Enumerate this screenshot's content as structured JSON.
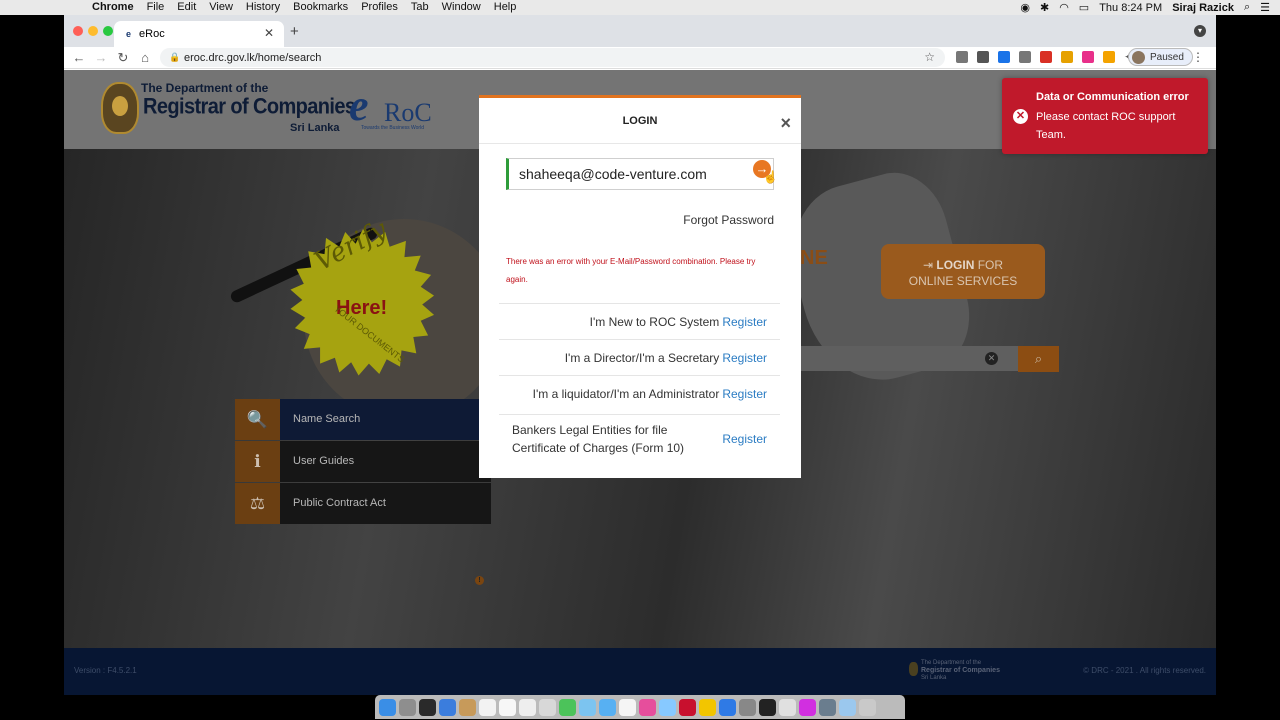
{
  "menubar": {
    "app": "Chrome",
    "items": [
      "File",
      "Edit",
      "View",
      "History",
      "Bookmarks",
      "Profiles",
      "Tab",
      "Window",
      "Help"
    ],
    "clock": "Thu 8:24 PM",
    "user": "Siraj Razick"
  },
  "browser": {
    "tab_title": "eRoc",
    "url": "eroc.drc.gov.lk/home/search",
    "profile_status": "Paused",
    "traffic_lights": [
      "#fe5f57",
      "#febc2e",
      "#28c840"
    ],
    "extension_colors": [
      "#777",
      "#555",
      "#1a73e8",
      "#777",
      "#d93025",
      "#e6a100",
      "#e8308a",
      "#f4a300"
    ]
  },
  "header": {
    "line1": "The Department of the",
    "line2": "Registrar of Companies",
    "line3": "Sri Lanka",
    "logo_e": "e",
    "logo_roc": "RoC",
    "logo_tagline": "Towards the Business World"
  },
  "hero": {
    "seal_top": "Verify",
    "seal_mid": "Here!",
    "seal_bottom": "YOUR DOCUMENTS",
    "partial_text": "NE",
    "login_button_bold": "LOGIN",
    "login_button_rest": " FOR",
    "login_button_line2": "ONLINE SERVICES",
    "search_icon": "search-icon",
    "clear_icon": "close-icon"
  },
  "side_menu": [
    {
      "label": "Name Search",
      "icon": "search-icon",
      "glyph": "🔍"
    },
    {
      "label": "User Guides",
      "icon": "info-icon",
      "glyph": "ℹ"
    },
    {
      "label": "Public Contract Act",
      "icon": "scale-icon",
      "glyph": "⚖"
    }
  ],
  "footer": {
    "version": "Version : F4.5.2.1",
    "copyright": "© DRC - 2021 . All rights reserved.",
    "logo_line1": "The Department of the",
    "logo_line2": "Registrar of Companies",
    "logo_line3": "Sri Lanka"
  },
  "modal": {
    "title": "LOGIN",
    "email_value": "shaheeqa@code-venture.com",
    "forgot_password": "Forgot Password",
    "error": "There was an error with your E-Mail/Password combination. Please try again.",
    "register_rows": [
      {
        "text": "I'm New to ROC System",
        "link": "Register"
      },
      {
        "text": "I'm a Director/I'm a Secretary",
        "link": "Register"
      },
      {
        "text": "I'm a liquidator/I'm an Administrator",
        "link": "Register"
      },
      {
        "text_line1": "Bankers Legal Entities for file",
        "text_line2": "Certificate of Charges (Form 10)",
        "link": "Register"
      }
    ]
  },
  "toast": {
    "title": "Data or Communication error",
    "message": "Please contact ROC support Team.",
    "color": "#c0192b"
  },
  "dock_colors": [
    "#3a8ee6",
    "#8e8e8e",
    "#2a2a2a",
    "#3b7ddd",
    "#c79a5a",
    "#f2f2f2",
    "#f7f7f7",
    "#eeeeee",
    "#d8d8d8",
    "#4cc35a",
    "#7cc4f0",
    "#57b0f2",
    "#f5f5f5",
    "#e64e9c",
    "#87c9ff",
    "#c8102e",
    "#f2c500",
    "#2f7ae5",
    "#888",
    "#222",
    "#e0e0e0",
    "#d12fe0",
    "#6a7d8e",
    "#9bc8ee",
    "#c9c9c9"
  ]
}
